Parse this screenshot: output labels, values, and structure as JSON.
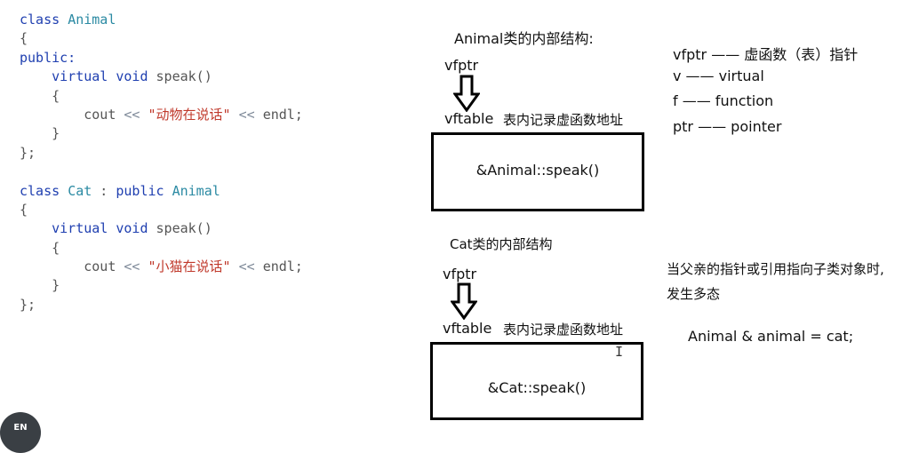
{
  "code": {
    "lines": [
      [
        {
          "t": "class ",
          "c": "kw"
        },
        {
          "t": "Animal",
          "c": "ty"
        }
      ],
      [
        {
          "t": "{",
          "c": "pl"
        }
      ],
      [
        {
          "t": "public:",
          "c": "kw"
        }
      ],
      [
        {
          "t": "    virtual void ",
          "c": "kw"
        },
        {
          "t": "speak()",
          "c": "pl"
        }
      ],
      [
        {
          "t": "    {",
          "c": "pl"
        }
      ],
      [
        {
          "t": "        cout ",
          "c": "pl"
        },
        {
          "t": "<< ",
          "c": "op"
        },
        {
          "t": "\"动物在说话\"",
          "c": "st"
        },
        {
          "t": " << ",
          "c": "op"
        },
        {
          "t": "endl;",
          "c": "pl"
        }
      ],
      [
        {
          "t": "    }",
          "c": "pl"
        }
      ],
      [
        {
          "t": "};",
          "c": "pl"
        }
      ],
      [],
      [
        {
          "t": "class ",
          "c": "kw"
        },
        {
          "t": "Cat",
          "c": "ty"
        },
        {
          "t": " : ",
          "c": "pl"
        },
        {
          "t": "public ",
          "c": "kw"
        },
        {
          "t": "Animal",
          "c": "ty"
        }
      ],
      [
        {
          "t": "{",
          "c": "pl"
        }
      ],
      [
        {
          "t": "    virtual void ",
          "c": "kw"
        },
        {
          "t": "speak()",
          "c": "pl"
        }
      ],
      [
        {
          "t": "    {",
          "c": "pl"
        }
      ],
      [
        {
          "t": "        cout ",
          "c": "pl"
        },
        {
          "t": "<< ",
          "c": "op"
        },
        {
          "t": "\"小猫在说话\"",
          "c": "st"
        },
        {
          "t": " << ",
          "c": "op"
        },
        {
          "t": "endl;",
          "c": "pl"
        }
      ],
      [
        {
          "t": "    }",
          "c": "pl"
        }
      ],
      [
        {
          "t": "};",
          "c": "pl"
        }
      ]
    ]
  },
  "animal_structure": {
    "title": "Animal类的内部结构:",
    "vfptr": "vfptr",
    "vftable": "vftable",
    "vftable_desc": "表内记录虚函数地址",
    "entry": "&Animal::speak()"
  },
  "cat_structure": {
    "title": "Cat类的内部结构",
    "vfptr": "vfptr",
    "vftable": "vftable",
    "vftable_desc": "表内记录虚函数地址",
    "entry": "&Cat::speak()"
  },
  "legend": [
    "vfptr —— 虚函数（表）指针",
    "v —— virtual",
    "f —— function",
    "ptr —— pointer"
  ],
  "note": {
    "line1": "当父亲的指针或引用指向子类对象时,",
    "line2": "发生多态",
    "example": "Animal & animal = cat;"
  },
  "cursor_glyph": "I",
  "badge": {
    "label": "EN"
  }
}
